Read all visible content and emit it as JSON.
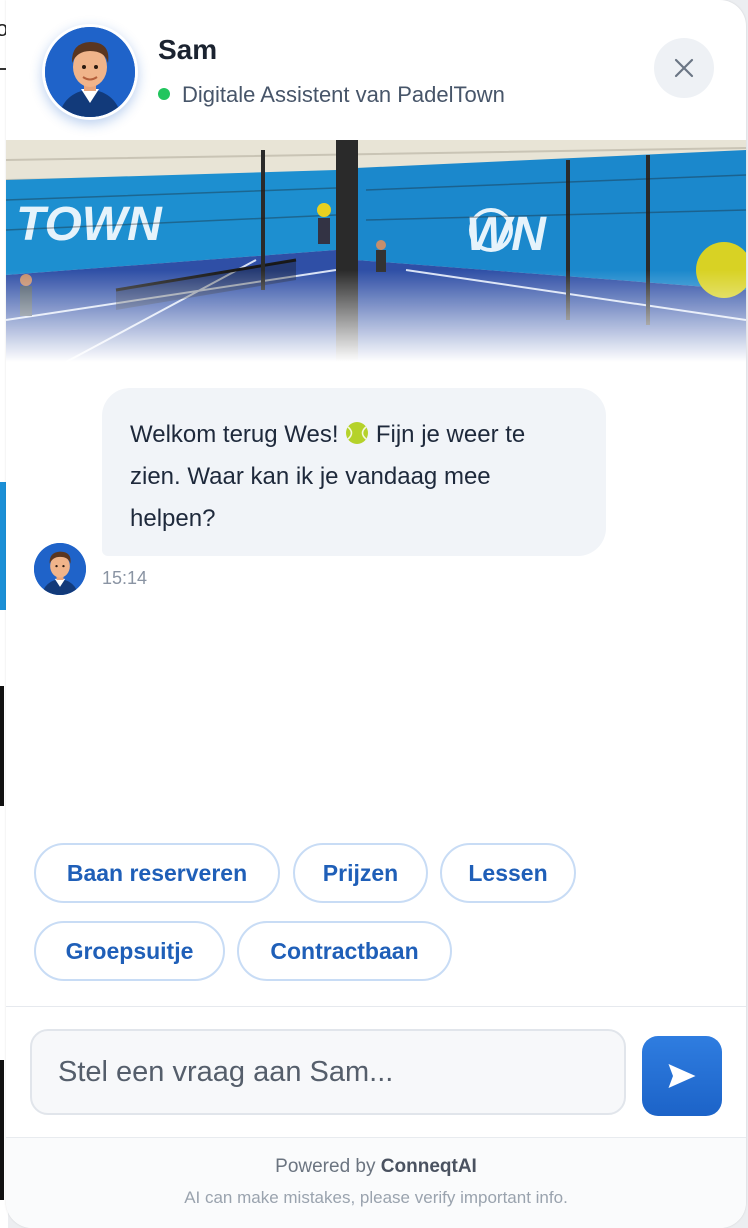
{
  "background_page": {
    "fragment_text": "oi"
  },
  "header": {
    "agent_name": "Sam",
    "status_text": "Digitale Assistent van PadelTown",
    "status_color": "#22c55e",
    "close_icon": "close-icon"
  },
  "banner": {
    "description_icon": "padel-court-photo"
  },
  "conversation": {
    "messages": [
      {
        "sender": "Sam",
        "text_before": "Welkom terug Wes! ",
        "emoji": "tennis-ball-icon",
        "text_after": " Fijn je weer te zien. Waar kan ik je vandaag mee helpen?",
        "time": "15:14"
      }
    ]
  },
  "quick_replies": [
    "Baan reserveren",
    "Prijzen",
    "Lessen",
    "Groepsuitje",
    "Contractbaan"
  ],
  "composer": {
    "placeholder": "Stel een vraag aan Sam...",
    "send_icon": "send-icon"
  },
  "footer": {
    "powered_prefix": "Powered by",
    "powered_brand": "ConneqtAI",
    "disclaimer": "AI can make mistakes, please verify important info."
  },
  "colors": {
    "accent": "#1f63c9",
    "chip_text": "#1f5fb8",
    "chip_border": "#c8dcf5"
  }
}
